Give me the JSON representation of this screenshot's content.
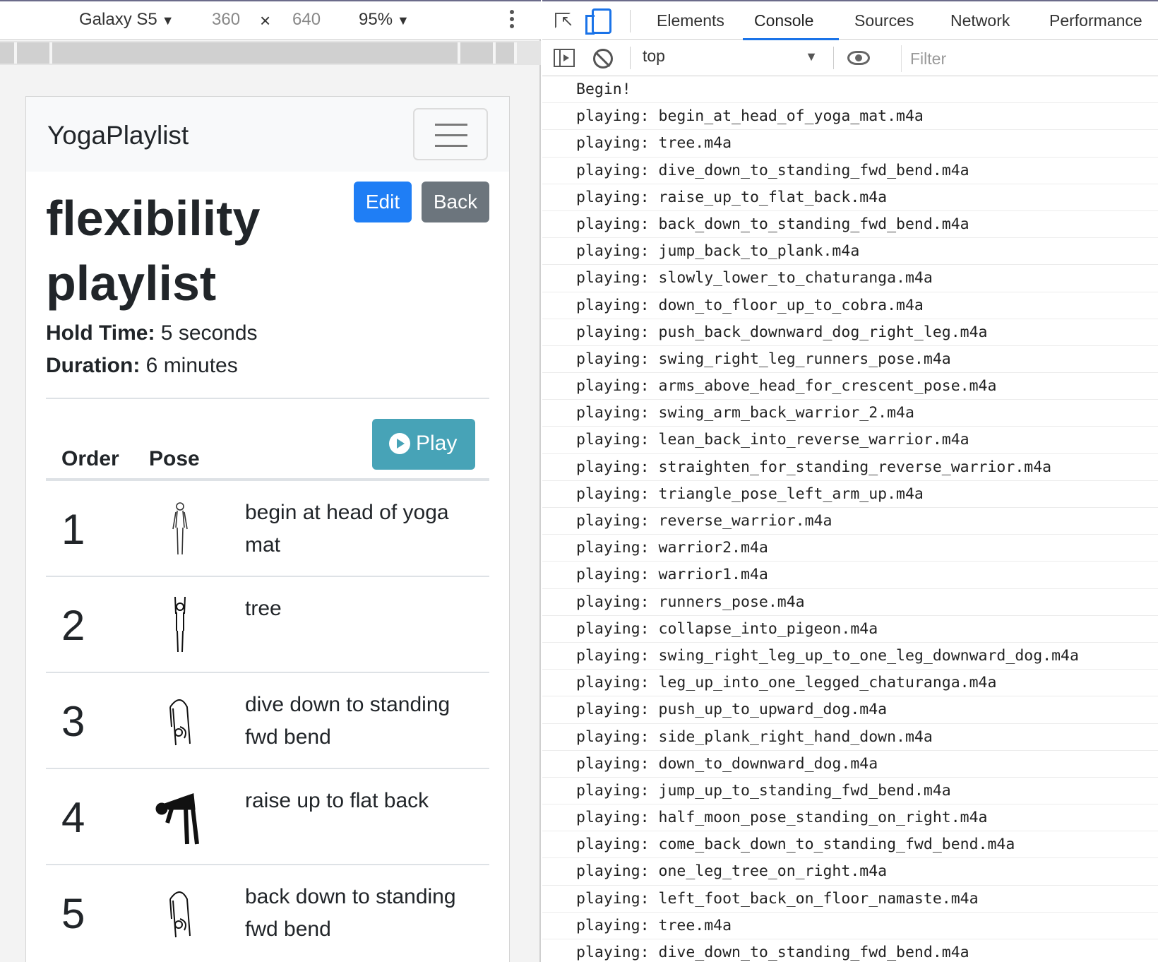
{
  "device_toolbar": {
    "device": "Galaxy S5",
    "width": "360",
    "times": "×",
    "height": "640",
    "zoom": "95%"
  },
  "app": {
    "brand": "YogaPlaylist",
    "title": "flexibility playlist",
    "edit_label": "Edit",
    "back_label": "Back",
    "hold_label": "Hold Time:",
    "hold_value": "5 seconds",
    "duration_label": "Duration:",
    "duration_value": "6 minutes",
    "col_order": "Order",
    "col_pose": "Pose",
    "play_label": "Play",
    "colors": {
      "edit": "#1f7ef5",
      "back": "#6c757d",
      "play": "#47a3b7"
    },
    "rows": [
      {
        "order": "1",
        "pose": "begin at head of yoga mat",
        "icon": "standing-figure-icon"
      },
      {
        "order": "2",
        "pose": "tree",
        "icon": "arms-up-figure-icon"
      },
      {
        "order": "3",
        "pose": "dive down to standing fwd bend",
        "icon": "forward-fold-figure-icon"
      },
      {
        "order": "4",
        "pose": "raise up to flat back",
        "icon": "flat-back-figure-icon"
      },
      {
        "order": "5",
        "pose": "back down to standing fwd bend",
        "icon": "forward-fold-figure-icon"
      }
    ]
  },
  "devtools": {
    "tabs": [
      "Elements",
      "Console",
      "Sources",
      "Network",
      "Performance"
    ],
    "active_tab": "Console",
    "context": "top",
    "filter_placeholder": "Filter",
    "log": [
      "Begin!",
      "playing: begin_at_head_of_yoga_mat.m4a",
      "playing: tree.m4a",
      "playing: dive_down_to_standing_fwd_bend.m4a",
      "playing: raise_up_to_flat_back.m4a",
      "playing: back_down_to_standing_fwd_bend.m4a",
      "playing: jump_back_to_plank.m4a",
      "playing: slowly_lower_to_chaturanga.m4a",
      "playing: down_to_floor_up_to_cobra.m4a",
      "playing: push_back_downward_dog_right_leg.m4a",
      "playing: swing_right_leg_runners_pose.m4a",
      "playing: arms_above_head_for_crescent_pose.m4a",
      "playing: swing_arm_back_warrior_2.m4a",
      "playing: lean_back_into_reverse_warrior.m4a",
      "playing: straighten_for_standing_reverse_warrior.m4a",
      "playing: triangle_pose_left_arm_up.m4a",
      "playing: reverse_warrior.m4a",
      "playing: warrior2.m4a",
      "playing: warrior1.m4a",
      "playing: runners_pose.m4a",
      "playing: collapse_into_pigeon.m4a",
      "playing: swing_right_leg_up_to_one_leg_downward_dog.m4a",
      "playing: leg_up_into_one_legged_chaturanga.m4a",
      "playing: push_up_to_upward_dog.m4a",
      "playing: side_plank_right_hand_down.m4a",
      "playing: down_to_downward_dog.m4a",
      "playing: jump_up_to_standing_fwd_bend.m4a",
      "playing: half_moon_pose_standing_on_right.m4a",
      "playing: come_back_down_to_standing_fwd_bend.m4a",
      "playing: one_leg_tree_on_right.m4a",
      "playing: left_foot_back_on_floor_namaste.m4a",
      "playing: tree.m4a",
      "playing: dive_down_to_standing_fwd_bend.m4a"
    ]
  }
}
